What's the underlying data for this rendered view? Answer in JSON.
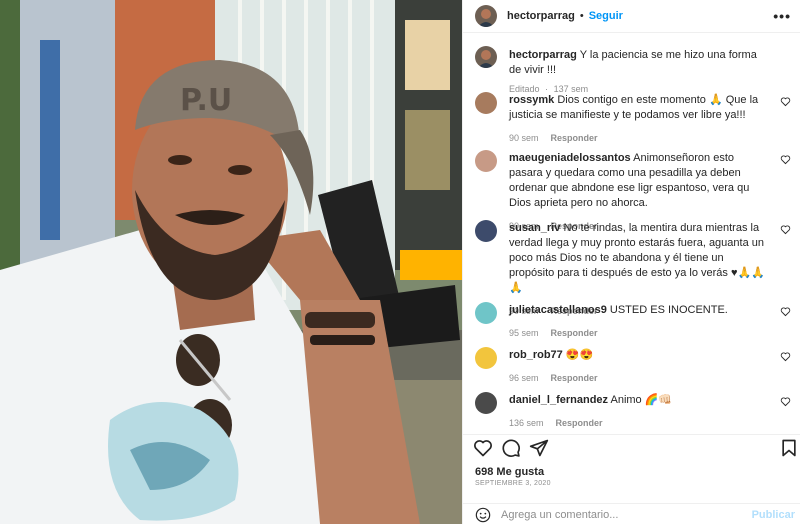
{
  "post": {
    "author": "hectorparrag",
    "separator": "•",
    "follow_label": "Seguir",
    "more_icon": "more-horizontal-icon",
    "caption_user": "hectorparrag",
    "caption_text": "Y la paciencia se me hizo una forma de vivir !!!",
    "caption_edited": "Editado",
    "caption_dot": "·",
    "caption_time": "137 sem",
    "likes": "698 Me gusta",
    "date": "SEPTIEMBRE 3, 2020"
  },
  "photo": {
    "cap_text": "P.U",
    "description_icon": "selfie-photo"
  },
  "comments": [
    {
      "user": "rossymk",
      "text": "Dios contigo en este momento 🙏 Que la justicia se manifieste y te podamos ver libre ya!!!",
      "time": "90 sem",
      "reply": "Responder",
      "avatar_color": "#a77b5e"
    },
    {
      "user": "maeugeniadelossantos",
      "text": "Animonseñoron esto pasara y quedara como una pesadilla ya deben ordenar que abndone ese ligr espantoso, vera qu Dios aprieta pero no ahorca.",
      "time": "90 sem",
      "reply": "Responder",
      "avatar_color": "#c79a86"
    },
    {
      "user": "susan_riv",
      "text": "No te rindas, la mentira dura mientras la verdad llega y muy pronto estarás fuera, aguanta un poco más Dios no te abandona y él tiene un propósito para ti después de esto ya lo verás ♥🙏🙏🙏",
      "time": "90 sem",
      "reply": "Responder",
      "avatar_color": "#3d4b6b"
    },
    {
      "user": "julietacastellanos9",
      "text": "USTED ES INOCENTE.",
      "time": "95 sem",
      "reply": "Responder",
      "avatar_color": "#6fc5c8"
    },
    {
      "user": "rob_rob77",
      "text": "😍😍",
      "time": "96 sem",
      "reply": "Responder",
      "avatar_color": "#f2c53d"
    },
    {
      "user": "daniel_l_fernandez",
      "text": "Animo 🌈👊🏻",
      "time": "136 sem",
      "reply": "Responder",
      "avatar_color": "#4a4a4a"
    }
  ],
  "actions": {
    "like_icon": "heart-icon",
    "comment_icon": "comment-icon",
    "share_icon": "send-icon",
    "save_icon": "bookmark-icon"
  },
  "add_comment": {
    "placeholder": "Agrega un comentario...",
    "publish_label": "Publicar",
    "emoji_icon": "emoji-icon"
  }
}
